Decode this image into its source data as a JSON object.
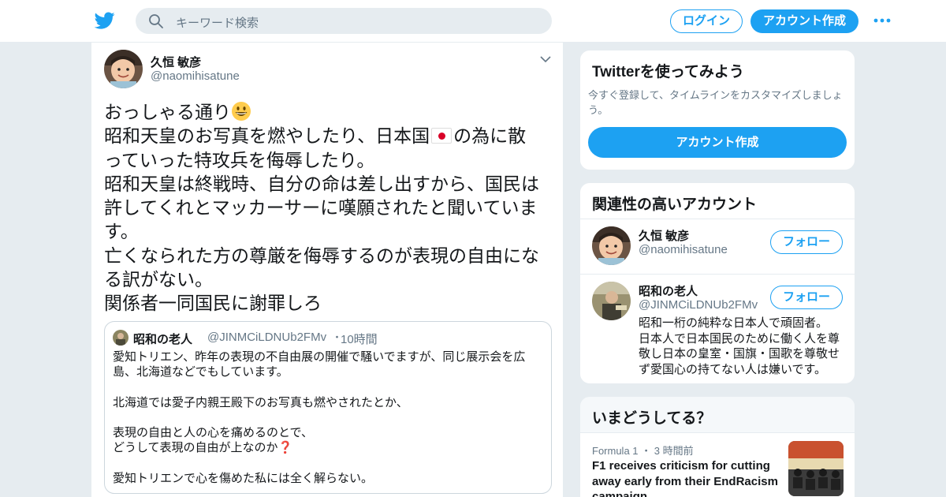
{
  "header": {
    "search_placeholder": "キーワード検索",
    "login_label": "ログイン",
    "signup_label": "アカウント作成"
  },
  "tweet": {
    "author_name": "久恒 敏彦",
    "author_handle": "@naomihisatune",
    "lines": [
      "おっしゃる通り",
      "昭和天皇のお写真を燃やしたり、日本国",
      "の為に散",
      "っていった特攻兵を侮辱したり。",
      "昭和天皇は終戦時、自分の命は差し出すから、国民は",
      "許してくれとマッカーサーに嘆願されたと聞いていま",
      "す。",
      "亡くなられた方の尊厳を侮辱するのが表現の自由にな",
      "る訳がない。",
      "関係者一同国民に謝罪しろ"
    ],
    "quote": {
      "author_name": "昭和の老人",
      "author_handle": "@JINMCiLDNUb2FMv",
      "separator": "・",
      "time": "10時間",
      "lines": [
        "愛知トリエン、昨年の表現の不自由展の開催で騒いでますが、同じ展示会を広",
        "島、北海道などでもしています。",
        "",
        "北海道では愛子内親王殿下のお写真も燃やされたとか、",
        "",
        "表現の自由と人の心を痛めるのとで、",
        "どうして表現の自由が上なのか",
        "",
        "愛知トリエンで心を傷めた私には全く解らない。"
      ],
      "question_mark": "❓"
    }
  },
  "sidebar": {
    "try_card": {
      "title": "Twitterを使ってみよう",
      "subtitle": "今すぐ登録して、タイムラインをカスタマイズしましょう。",
      "button": "アカウント作成"
    },
    "related_card": {
      "title": "関連性の高いアカウント",
      "accounts": [
        {
          "name": "久恒 敏彦",
          "handle": "@naomihisatune",
          "follow_label": "フォロー"
        },
        {
          "name": "昭和の老人",
          "handle": "@JINMCiLDNUb2FMv",
          "follow_label": "フォロー",
          "bio_lines": [
            "昭和一桁の純粋な日本人で頑固者。",
            "日本人で日本国民のために働く人を尊",
            "敬し日本の皇室・国旗・国歌を尊敬せ",
            "ず愛国心の持てない人は嫌いです。"
          ]
        }
      ]
    },
    "trends_card": {
      "title": "いまどうしてる？",
      "trend": {
        "category": "Formula 1",
        "separator": "・",
        "time": "3 時間前",
        "title_lines": [
          "F1 receives criticism for cutting",
          "away early from their EndRacism",
          "campaign"
        ]
      }
    }
  },
  "colors": {
    "accent": "#1da1f2",
    "secondary_text": "#657786",
    "border": "#e6ecf0",
    "background": "#e6ecf0"
  }
}
